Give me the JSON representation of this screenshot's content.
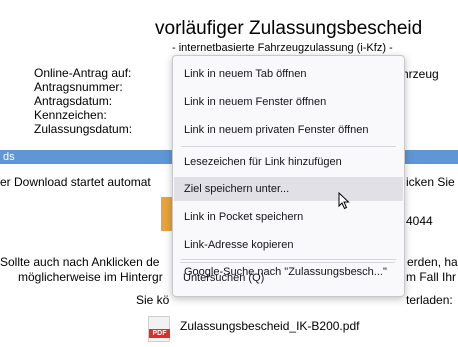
{
  "page": {
    "title": "vorläufiger Zulassungsbescheid",
    "subtitle": "- internetbasierte Fahrzeugzulassung (i-Kfz) -",
    "fields": [
      "Online-Antrag auf:",
      "Antragsnummer:",
      "Antragsdatum:",
      "Kennzeichen:",
      "Zulassungsdatum:"
    ],
    "partial_value": "hrzeug"
  },
  "downloads": {
    "bar_label": "ds",
    "line1_left": "er Download startet automat",
    "line1_right": "icken Sie",
    "number_right": "4044",
    "line2_left": "Sollte auch nach Anklicken de",
    "line2_right": "erden, ha",
    "line3_left": "möglicherweise im Hintergr",
    "line3_right": "m Fall Ihr",
    "line4_left": "Sie kö",
    "line4_right": "terladen:",
    "pdf_tag": "PDF",
    "pdf_filename": "Zulassungsbescheid_IK-B200.pdf"
  },
  "context_menu": {
    "items": [
      "Link in neuem Tab öffnen",
      "Link in neuem Fenster öffnen",
      "Link in neuem privaten Fenster öffnen",
      "Lesezeichen für Link hinzufügen",
      "Ziel speichern unter...",
      "Link in Pocket speichern",
      "Link-Adresse kopieren",
      "Google-Suche nach \"Zulassungsbesch...\"",
      "Untersuchen (Q)"
    ],
    "hovered_index": 4
  },
  "colors": {
    "downloads_bar": "#5f96d5",
    "menu_bg": "#f9f9fb",
    "menu_hover": "#e0e0e6"
  }
}
